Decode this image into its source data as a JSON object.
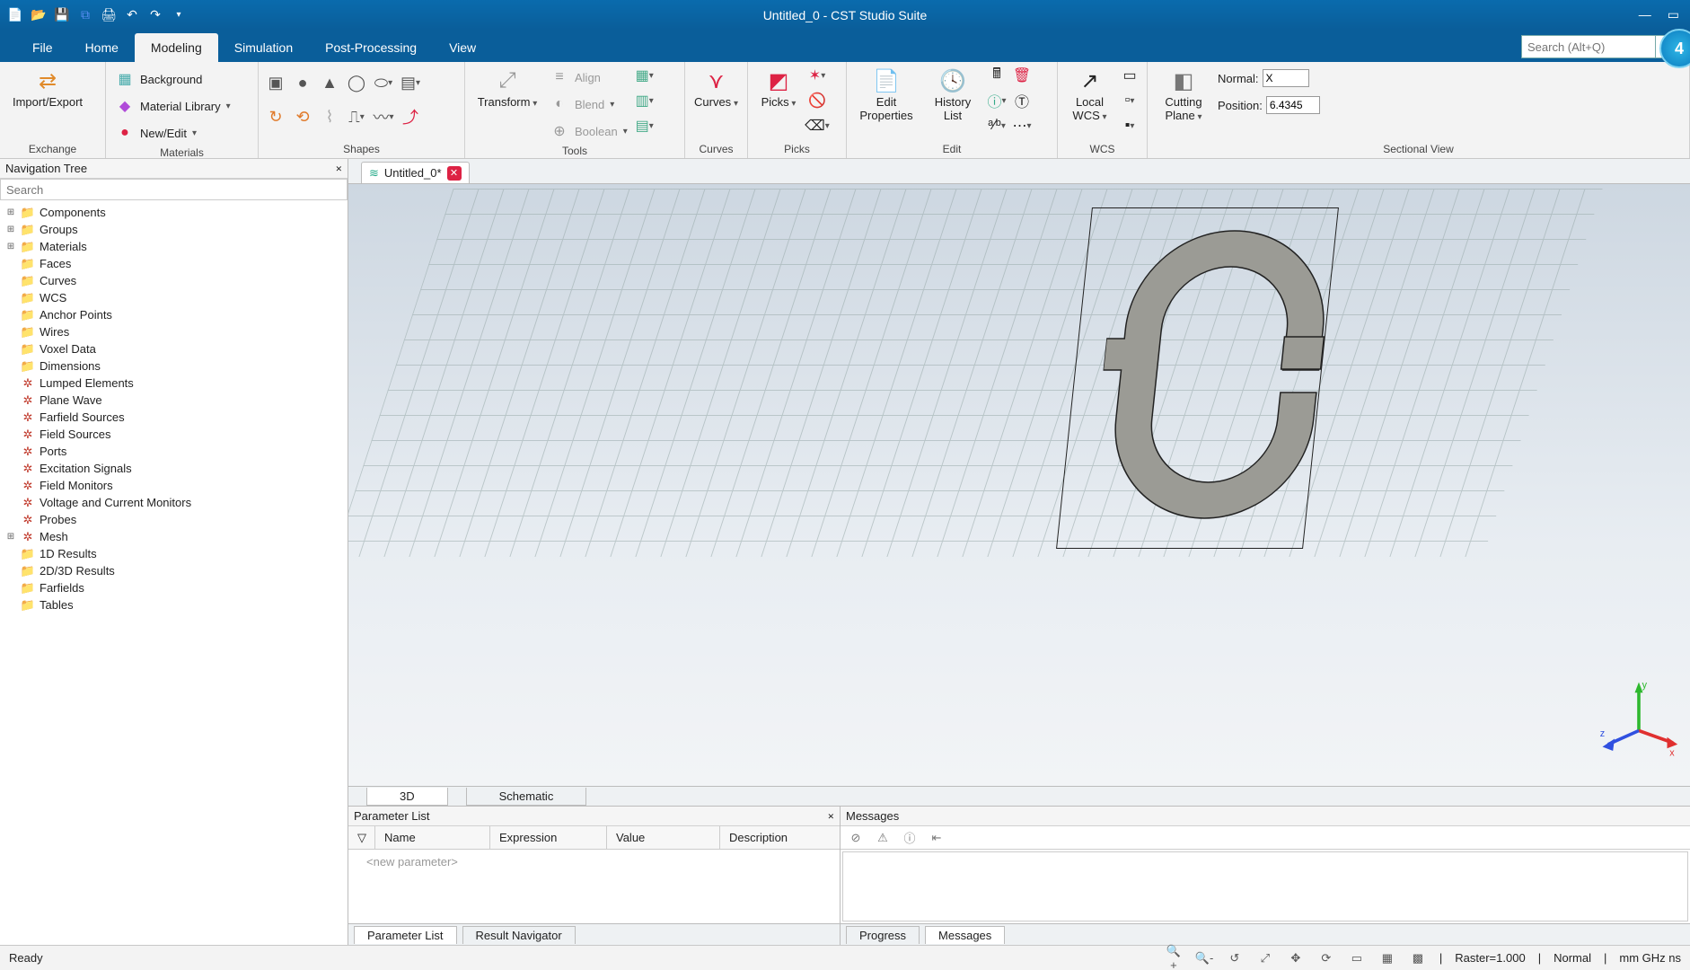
{
  "title": "Untitled_0 - CST Studio Suite",
  "badge": "4",
  "search_placeholder": "Search (Alt+Q)",
  "menus": {
    "file": "File",
    "home": "Home",
    "modeling": "Modeling",
    "simulation": "Simulation",
    "post": "Post-Processing",
    "view": "View"
  },
  "ribbon": {
    "exchange": {
      "import": "Import/Export",
      "lab": "Exchange"
    },
    "materials": {
      "bg": "Background",
      "lib": "Material Library",
      "newedit": "New/Edit",
      "lab": "Materials"
    },
    "shapes": {
      "lab": "Shapes"
    },
    "tools": {
      "transform": "Transform",
      "align": "Align",
      "blend": "Blend",
      "boolean": "Boolean",
      "lab": "Tools"
    },
    "curves": {
      "btn": "Curves",
      "lab": "Curves"
    },
    "picks": {
      "btn": "Picks",
      "lab": "Picks"
    },
    "edit": {
      "props": "Edit\nProperties",
      "hist": "History\nList",
      "lab": "Edit"
    },
    "wcs": {
      "btn": "Local\nWCS",
      "lab": "WCS"
    },
    "sect": {
      "btn": "Cutting\nPlane",
      "normal_l": "Normal:",
      "normal_v": "X",
      "pos_l": "Position:",
      "pos_v": "6.4345",
      "lab": "Sectional View"
    }
  },
  "nav": {
    "title": "Navigation Tree",
    "search": "Search",
    "items": [
      {
        "exp": "⊞",
        "ic": "fold",
        "t": "Components"
      },
      {
        "exp": "⊞",
        "ic": "fold",
        "t": "Groups"
      },
      {
        "exp": "⊞",
        "ic": "fold",
        "t": "Materials"
      },
      {
        "exp": "",
        "ic": "fold",
        "t": "Faces"
      },
      {
        "exp": "",
        "ic": "fold",
        "t": "Curves"
      },
      {
        "exp": "",
        "ic": "fold",
        "t": "WCS"
      },
      {
        "exp": "",
        "ic": "fold",
        "t": "Anchor Points"
      },
      {
        "exp": "",
        "ic": "fold",
        "t": "Wires"
      },
      {
        "exp": "",
        "ic": "fold",
        "t": "Voxel Data"
      },
      {
        "exp": "",
        "ic": "fold",
        "t": "Dimensions"
      },
      {
        "exp": "",
        "ic": "gear",
        "t": "Lumped Elements"
      },
      {
        "exp": "",
        "ic": "gear",
        "t": "Plane Wave"
      },
      {
        "exp": "",
        "ic": "gear",
        "t": "Farfield Sources"
      },
      {
        "exp": "",
        "ic": "gear",
        "t": "Field Sources"
      },
      {
        "exp": "",
        "ic": "gear",
        "t": "Ports"
      },
      {
        "exp": "",
        "ic": "gear",
        "t": "Excitation Signals"
      },
      {
        "exp": "",
        "ic": "gear",
        "t": "Field Monitors"
      },
      {
        "exp": "",
        "ic": "gear",
        "t": "Voltage and Current Monitors"
      },
      {
        "exp": "",
        "ic": "gear",
        "t": "Probes"
      },
      {
        "exp": "⊞",
        "ic": "gear",
        "t": "Mesh"
      },
      {
        "exp": "",
        "ic": "fold",
        "t": "1D Results"
      },
      {
        "exp": "",
        "ic": "fold",
        "t": "2D/3D Results"
      },
      {
        "exp": "",
        "ic": "fold",
        "t": "Farfields"
      },
      {
        "exp": "",
        "ic": "fold",
        "t": "Tables"
      }
    ]
  },
  "doc": {
    "tab": "Untitled_0*",
    "v3d": "3D",
    "vsch": "Schematic"
  },
  "param": {
    "title": "Parameter List",
    "c1": "Name",
    "c2": "Expression",
    "c3": "Value",
    "c4": "Description",
    "ph": "<new parameter>",
    "t1": "Parameter List",
    "t2": "Result Navigator"
  },
  "msgs": {
    "title": "Messages",
    "t1": "Progress",
    "t2": "Messages"
  },
  "status": {
    "ready": "Ready",
    "raster": "Raster=1.000",
    "normal": "Normal",
    "unit": "mm  GHz  ns"
  },
  "axes": {
    "x": "x",
    "y": "y",
    "z": "z"
  }
}
